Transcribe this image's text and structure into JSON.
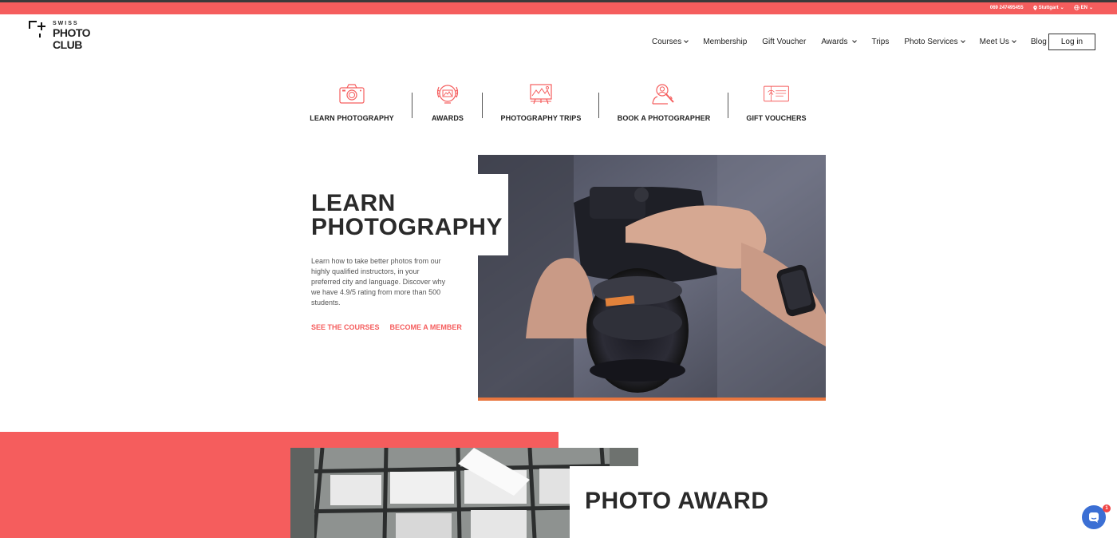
{
  "topbar": {
    "phone": "069 247495455",
    "city": "Stuttgart",
    "language": "EN",
    "bg_color": "#f55d5d"
  },
  "logo": {
    "line1": "SWISS",
    "line2": "PHOTO",
    "line3": "CLUB"
  },
  "nav": {
    "items": [
      {
        "label": "Courses",
        "dropdown": true
      },
      {
        "label": "Membership",
        "dropdown": false
      },
      {
        "label": "Gift Voucher",
        "dropdown": false
      },
      {
        "label": "Awards",
        "dropdown": true
      },
      {
        "label": "Trips",
        "dropdown": false
      },
      {
        "label": "Photo Services",
        "dropdown": true
      },
      {
        "label": "Meet Us",
        "dropdown": true
      },
      {
        "label": "Blog",
        "dropdown": true
      }
    ],
    "login_label": "Log in"
  },
  "categories": [
    {
      "label": "LEARN PHOTOGRAPHY",
      "icon": "camera-icon"
    },
    {
      "label": "AWARDS",
      "icon": "award-icon"
    },
    {
      "label": "PHOTOGRAPHY TRIPS",
      "icon": "trip-icon"
    },
    {
      "label": "BOOK A PHOTOGRAPHER",
      "icon": "photographer-icon"
    },
    {
      "label": "GIFT VOUCHERS",
      "icon": "voucher-icon"
    }
  ],
  "hero": {
    "title_line1": "LEARN",
    "title_line2": "PHOTOGRAPHY",
    "description": "Learn how to take better photos from our highly qualified instructors, in your preferred city and language. Discover why we have 4.9/5 rating from more than 500 students.",
    "link1": "SEE THE COURSES",
    "link2": "BECOME A MEMBER"
  },
  "award_section": {
    "title": "PHOTO AWARD"
  },
  "chat": {
    "badge_count": "1"
  },
  "colors": {
    "accent": "#f55d5d",
    "chat": "#3b6fd4"
  }
}
